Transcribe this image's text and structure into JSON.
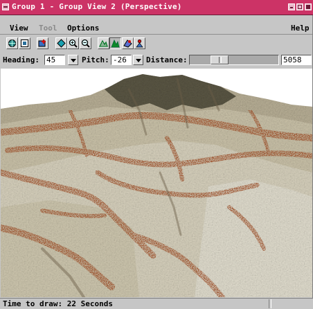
{
  "window": {
    "title": "Group 1 - Group View 2 (Perspective)"
  },
  "menubar": {
    "items": [
      {
        "label": "View",
        "enabled": true
      },
      {
        "label": "Tool",
        "enabled": false
      },
      {
        "label": "Options",
        "enabled": true
      }
    ],
    "help": "Help"
  },
  "toolbar": {
    "tools": [
      {
        "icon": "globe-icon",
        "pressed": false
      },
      {
        "icon": "frame-icon",
        "pressed": false
      },
      {
        "icon": "layer-add-icon",
        "pressed": false
      },
      {
        "icon": "diamond-icon",
        "pressed": false
      },
      {
        "icon": "zoom-in-icon",
        "pressed": false
      },
      {
        "icon": "zoom-out-icon",
        "pressed": false
      },
      {
        "icon": "terrain-wire-icon",
        "pressed": false
      },
      {
        "icon": "terrain-fill-icon",
        "pressed": true
      },
      {
        "icon": "surface-icon",
        "pressed": false
      },
      {
        "icon": "viewer-icon",
        "pressed": false
      }
    ]
  },
  "controls": {
    "heading_label": "Heading:",
    "heading_value": "45",
    "pitch_label": "Pitch:",
    "pitch_value": "-26",
    "distance_label": "Distance:",
    "distance_value": "5058",
    "distance_slider_fraction": 0.29
  },
  "status": {
    "text": "Time to draw: 22 Seconds"
  },
  "colors": {
    "titlebar": "#cc3366",
    "chrome": "#c6c6c6",
    "sky": "#ffffff",
    "terrain_light": "#d9d3bf",
    "terrain_mid": "#a99f83",
    "terrain_rust": "#9a4d28",
    "terrain_dark": "#4d4a3b"
  }
}
